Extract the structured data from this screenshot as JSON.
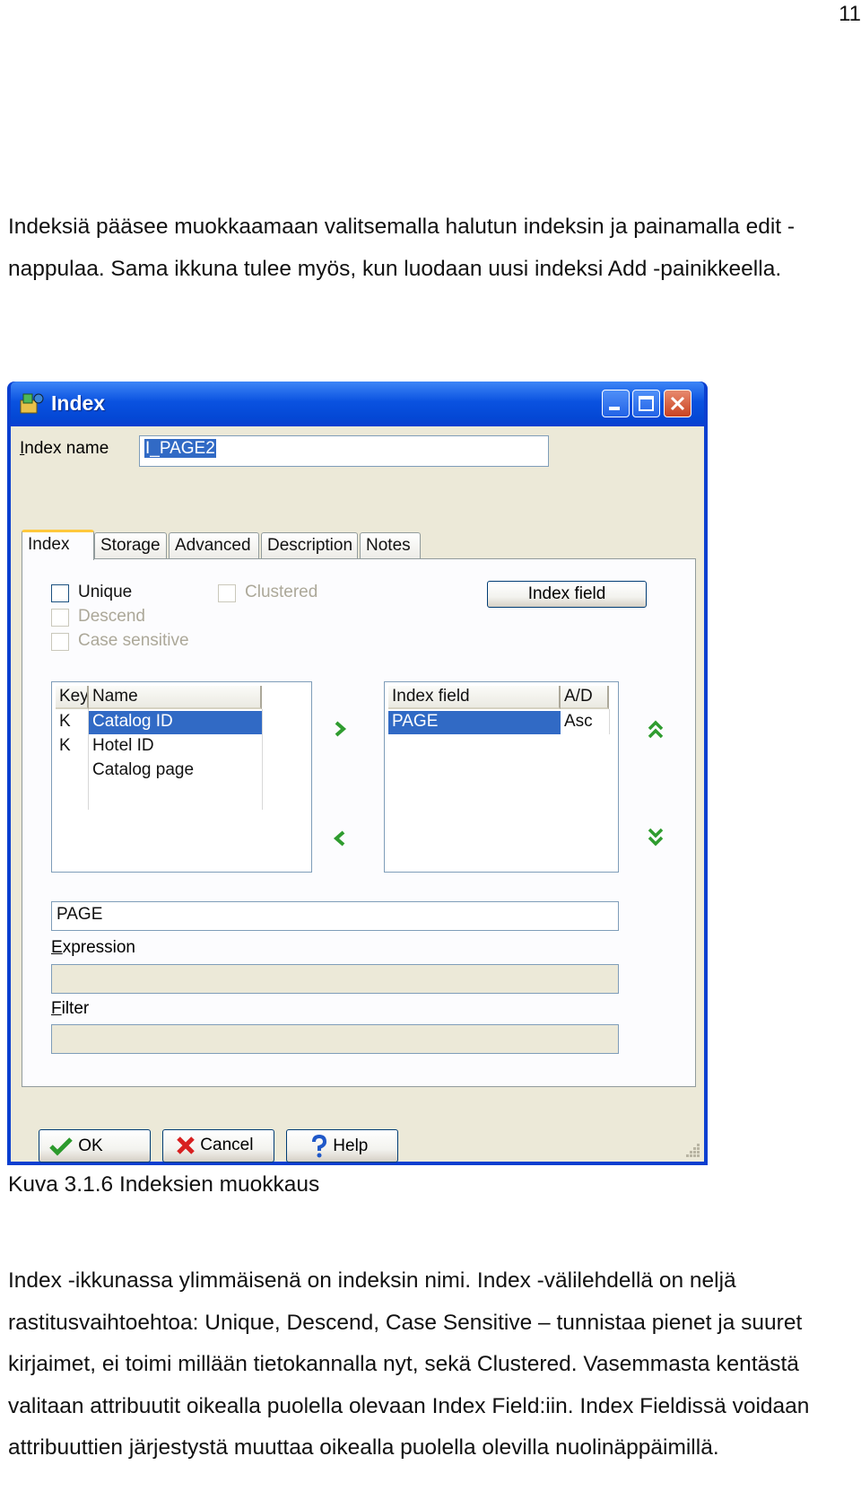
{
  "page_number": "11",
  "intro": "Indeksiä pääsee muokkaamaan valitsemalla halutun indeksin ja painamalla edit -nappulaa. Sama ikkuna tulee myös, kun luodaan uusi indeksi Add -painikkeella.",
  "caption": "Kuva 3.1.6 Indeksien muokkaus",
  "body": "Index -ikkunassa ylimmäisenä on indeksin nimi. Index -välilehdellä on neljä rastitusvaihtoehtoa: Unique, Descend, Case Sensitive – tunnistaa pienet ja suuret kirjaimet, ei toimi millään tietokannalla nyt, sekä Clustered. Vasemmasta kentästä valitaan attribuutit oikealla puolella olevaan Index Field:iin. Index Fieldissä voidaan attribuuttien järjestystä muuttaa oikealla puolella olevilla nuolinäppäimillä.",
  "window": {
    "title": "Index",
    "index_name_label": "Index name",
    "index_name_value": "I_PAGE2",
    "tabs": [
      "Index",
      "Storage",
      "Advanced",
      "Description",
      "Notes"
    ],
    "checkboxes": {
      "unique": "Unique",
      "descend": "Descend",
      "case_sensitive": "Case sensitive",
      "clustered": "Clustered"
    },
    "index_field_button": "Index field",
    "attributes_list": {
      "headers": [
        "Key",
        "Name"
      ],
      "rows": [
        {
          "key": "K",
          "name": "Catalog ID"
        },
        {
          "key": "K",
          "name": "Hotel ID"
        },
        {
          "key": "",
          "name": "Catalog page"
        }
      ]
    },
    "index_fields_list": {
      "headers": [
        "Index field",
        "A/D"
      ],
      "rows": [
        {
          "field": "PAGE",
          "ad": "Asc"
        }
      ]
    },
    "expression_value": "PAGE",
    "expression_label": "Expression",
    "filter_label": "Filter",
    "filter_value": "",
    "buttons": {
      "ok": "OK",
      "cancel": "Cancel",
      "help": "Help"
    }
  }
}
